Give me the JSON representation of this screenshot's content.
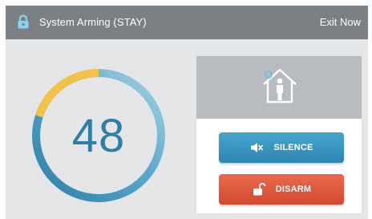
{
  "header": {
    "title": "System Arming (STAY)",
    "exit_label": "Exit Now",
    "lock_icon": "lock-icon"
  },
  "countdown": {
    "value": "48",
    "progress_fraction": 0.2,
    "colors": {
      "track": "#a9d3e3",
      "elapsed": "#f4c247",
      "remaining_start": "#2c7fa6",
      "remaining_end": "#a9d3e3"
    }
  },
  "panel": {
    "status_icon": "home-person-icon",
    "silence_label": "SILENCE",
    "silence_icon": "speaker-mute-icon",
    "disarm_label": "DISARM",
    "disarm_icon": "unlock-icon",
    "colors": {
      "silence": "#3a97c0",
      "disarm": "#de5a3c"
    }
  }
}
